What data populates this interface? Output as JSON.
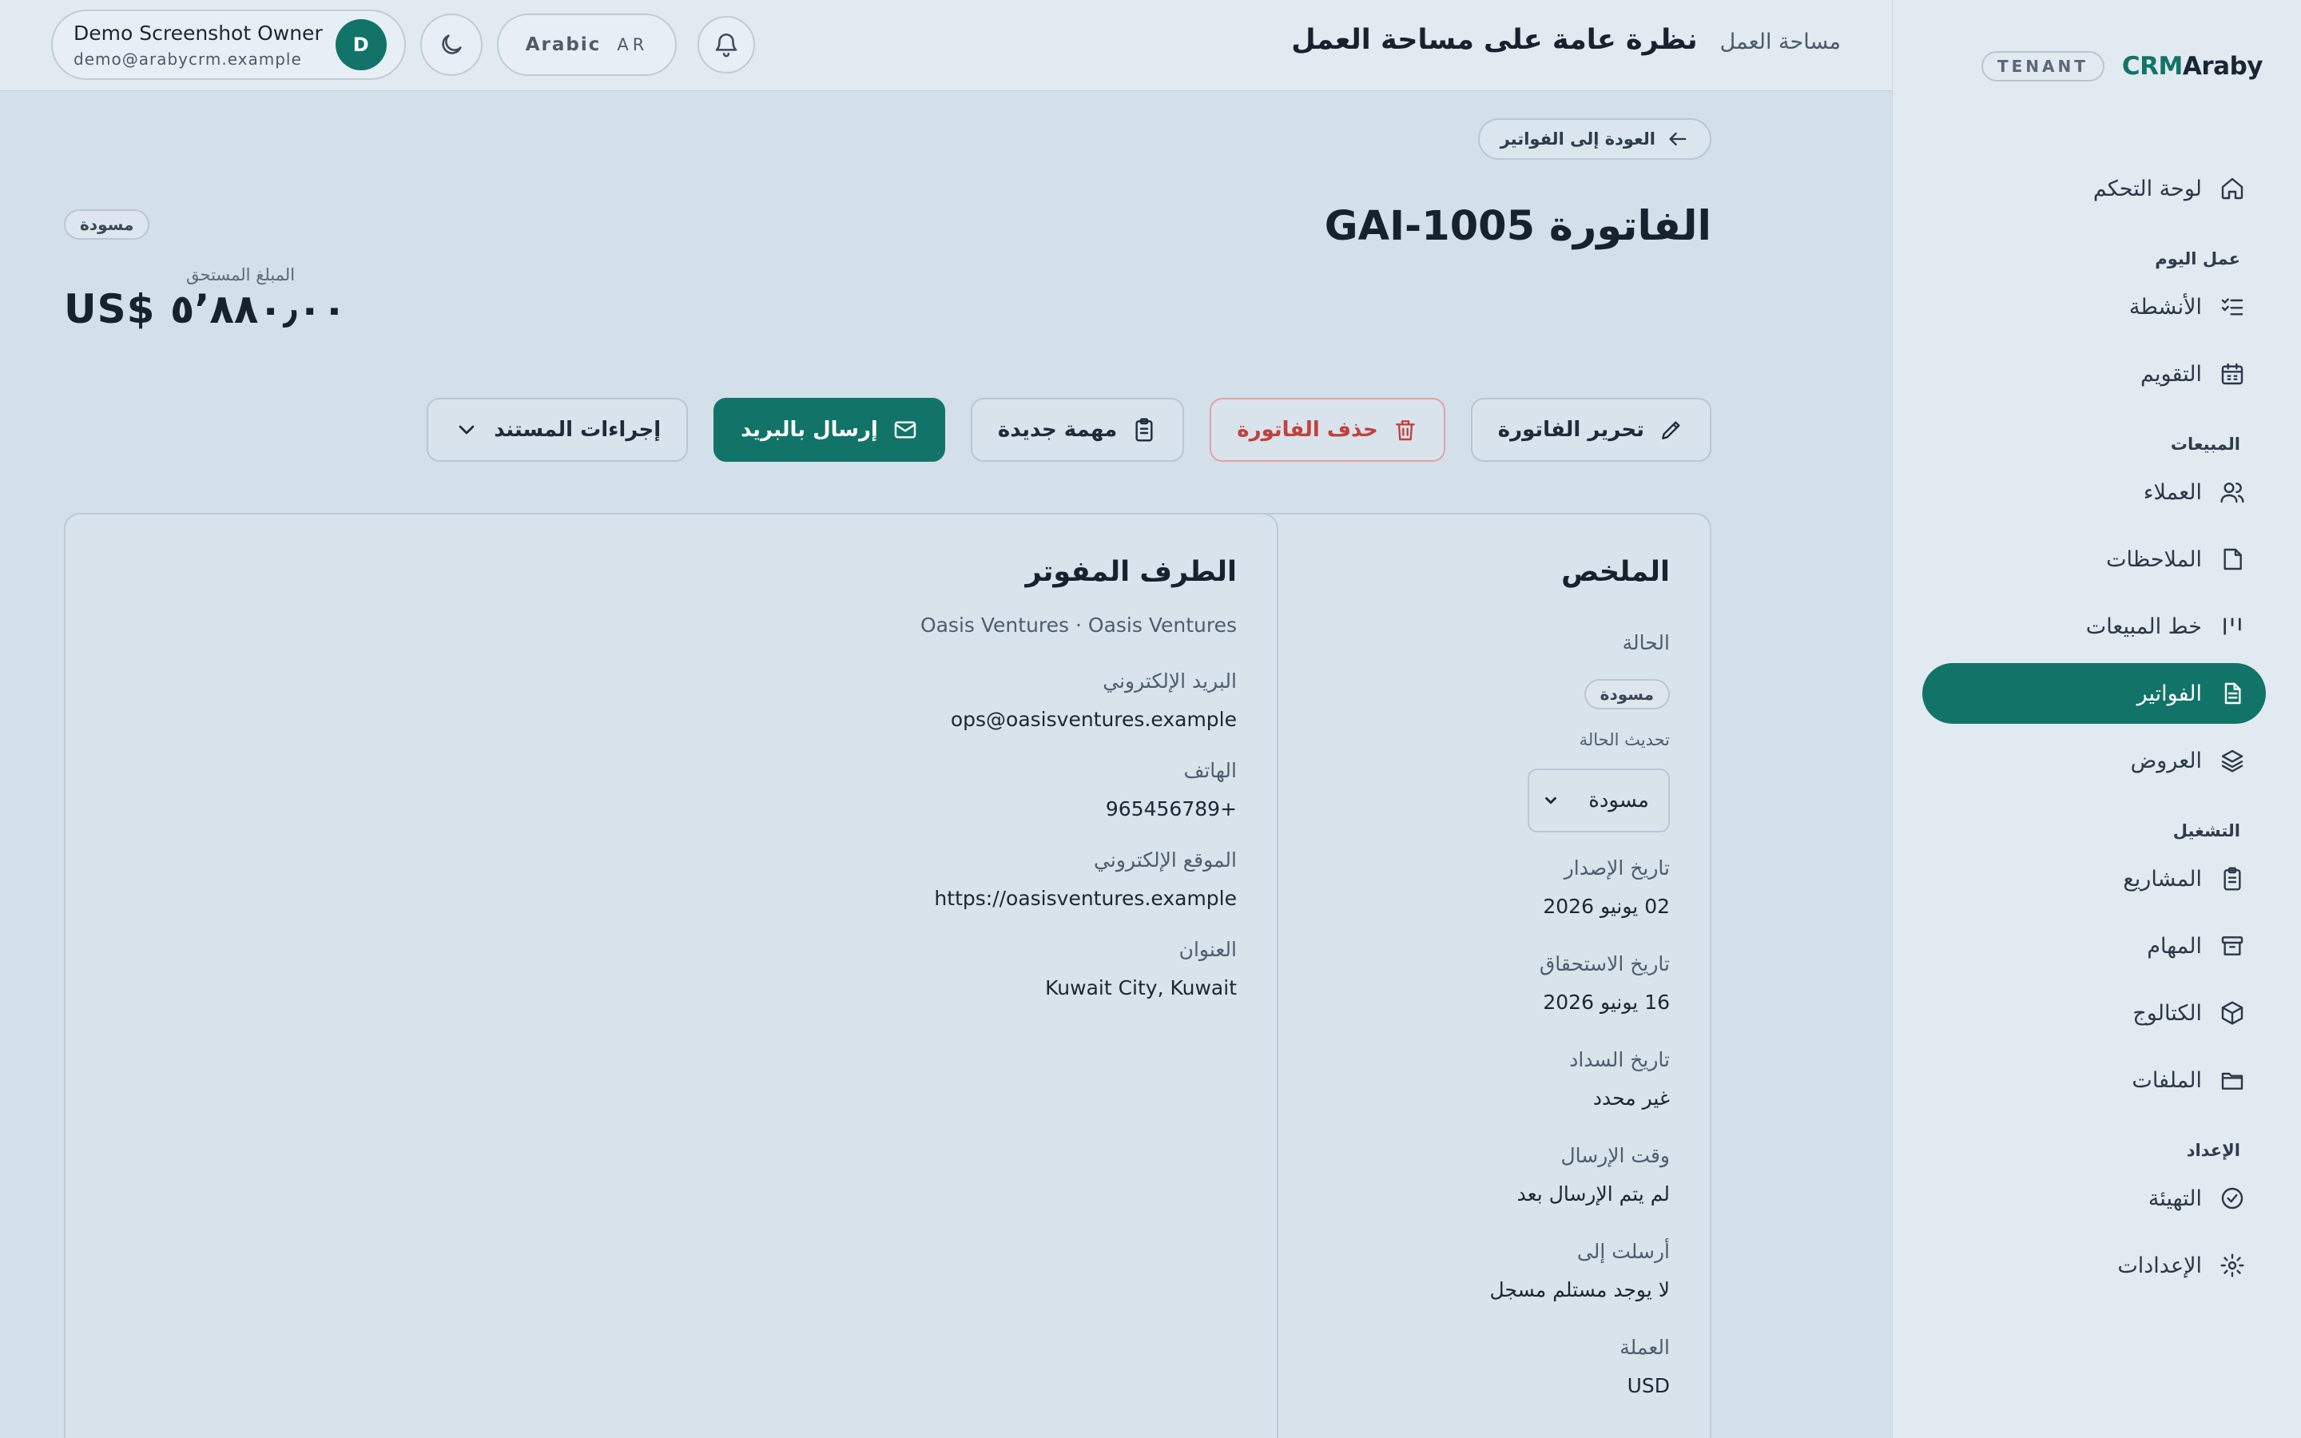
{
  "brand": {
    "crm": "CRM",
    "araby": "Araby",
    "tenant": "TENANT"
  },
  "sidebar": {
    "items": [
      {
        "label": "لوحة التحكم",
        "icon": "home-icon"
      },
      {
        "section": "عمل اليوم"
      },
      {
        "label": "الأنشطة",
        "icon": "list-check-icon"
      },
      {
        "label": "التقويم",
        "icon": "calendar-icon"
      },
      {
        "section": "المبيعات"
      },
      {
        "label": "العملاء",
        "icon": "users-icon"
      },
      {
        "label": "الملاحظات",
        "icon": "note-icon"
      },
      {
        "label": "خط المبيعات",
        "icon": "pipeline-icon"
      },
      {
        "label": "الفواتير",
        "icon": "invoice-icon",
        "active": true
      },
      {
        "label": "العروض",
        "icon": "layers-icon"
      },
      {
        "section": "التشغيل"
      },
      {
        "label": "المشاريع",
        "icon": "clipboard-icon"
      },
      {
        "label": "المهام",
        "icon": "archive-icon"
      },
      {
        "label": "الكتالوج",
        "icon": "package-icon"
      },
      {
        "label": "الملفات",
        "icon": "folder-icon"
      },
      {
        "section": "الإعداد"
      },
      {
        "label": "التهيئة",
        "icon": "check-circle-icon"
      },
      {
        "label": "الإعدادات",
        "icon": "gear-icon"
      }
    ]
  },
  "topbar": {
    "workspace": "مساحة العمل",
    "title": "نظرة عامة على مساحة العمل",
    "user_name": "Demo Screenshot Owner",
    "user_email": "demo@arabycrm.example",
    "avatar_letter": "D",
    "language": "Arabic",
    "language_code": "AR"
  },
  "page": {
    "back_label": "العودة إلى الفواتير",
    "invoice_title": "الفاتورة GAI-1005",
    "status_badge": "مسودة",
    "amount_label": "المبلغ المستحق",
    "amount": "US$ ٥٬٨٨٠٫٠٠"
  },
  "actions": {
    "edit": "تحرير الفاتورة",
    "delete": "حذف الفاتورة",
    "new_task": "مهمة جديدة",
    "send_email": "إرسال بالبريد",
    "document_actions": "إجراءات المستند"
  },
  "summary": {
    "title": "الملخص",
    "status_label": "الحالة",
    "status_value": "مسودة",
    "update_status_label": "تحديث الحالة",
    "update_status_selected": "مسودة",
    "issue_date_label": "تاريخ الإصدار",
    "issue_date": "02 يونيو 2026",
    "due_date_label": "تاريخ الاستحقاق",
    "due_date": "16 يونيو 2026",
    "payment_date_label": "تاريخ السداد",
    "payment_date": "غير محدد",
    "sent_time_label": "وقت الإرسال",
    "sent_time": "لم يتم الإرسال بعد",
    "sent_to_label": "أرسلت إلى",
    "sent_to": "لا يوجد مستلم مسجل",
    "currency_label": "العملة",
    "currency": "USD"
  },
  "billed_party": {
    "title": "الطرف المفوتر",
    "company_line": "Oasis Ventures · Oasis Ventures",
    "email_label": "البريد الإلكتروني",
    "email": "ops@oasisventures.example",
    "phone_label": "الهاتف",
    "phone": "+965456789",
    "website_label": "الموقع الإلكتروني",
    "website": "https://oasisventures.example",
    "address_label": "العنوان",
    "address": "Kuwait City, Kuwait"
  },
  "colors": {
    "accent": "#127468",
    "danger": "#c2413c",
    "background": "#d3dfe9"
  }
}
